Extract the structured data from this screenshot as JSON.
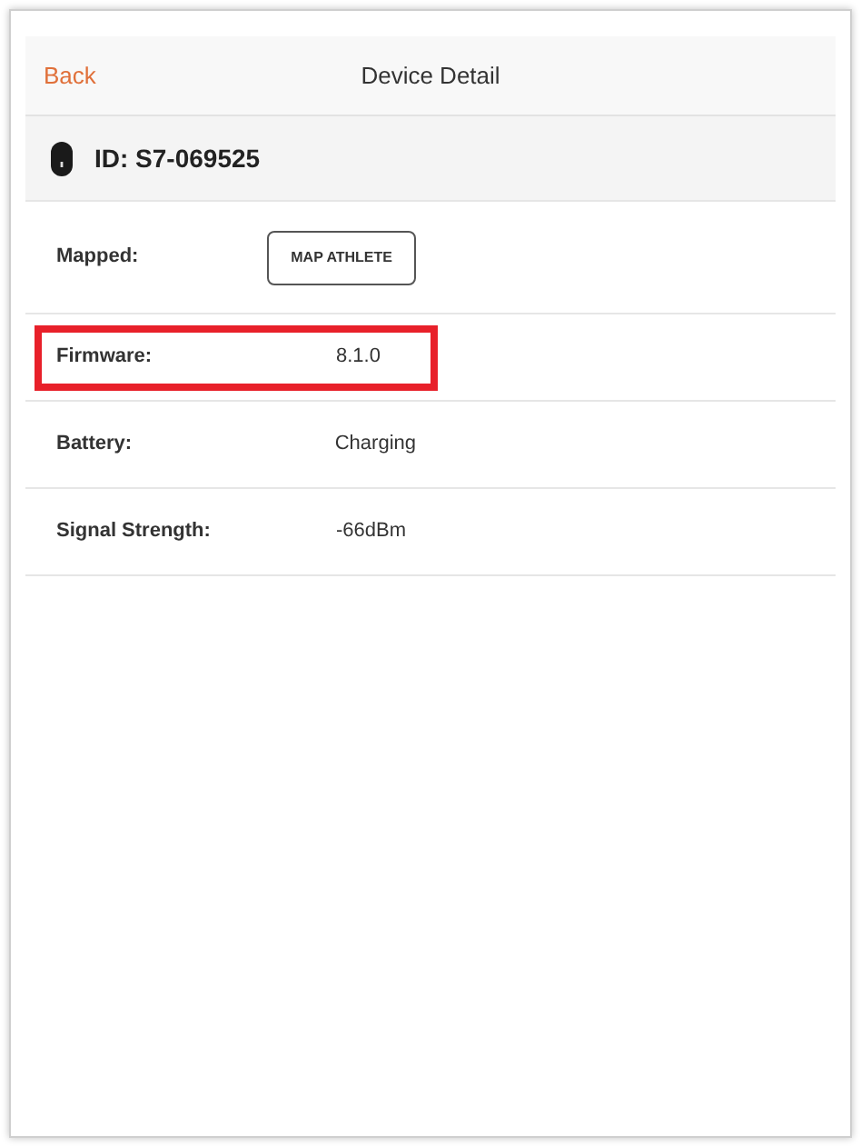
{
  "nav": {
    "back": "Back",
    "title": "Device Detail"
  },
  "device": {
    "id": "ID: S7-069525"
  },
  "rows": [
    {
      "kind": "button",
      "label": "Mapped:",
      "value": "MAP ATHLETE",
      "highlighted": false
    },
    {
      "kind": "text",
      "label": "Firmware:",
      "value": "8.1.0",
      "highlighted": true
    },
    {
      "kind": "text",
      "label": "Battery:",
      "value": "Charging",
      "highlighted": false
    },
    {
      "kind": "text",
      "label": "Signal Strength:",
      "value": "-66dBm",
      "highlighted": false
    }
  ]
}
